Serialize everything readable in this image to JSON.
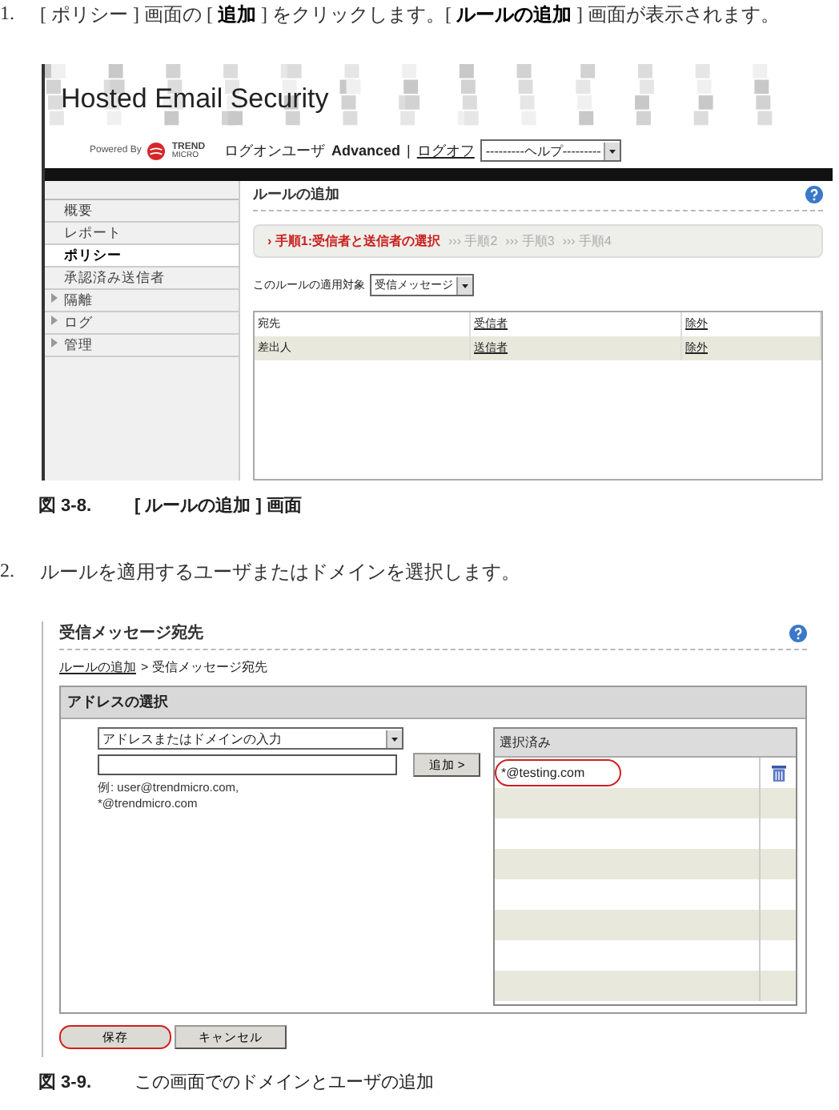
{
  "steps": [
    {
      "number": "1.",
      "text": "[ ポリシー ] 画面の [ **追加** ] をクリックします。[ **ルールの追加** ] 画面が表示されます。"
    },
    {
      "number": "2.",
      "text": "ルールを適用するユーザまたはドメインを選択します。"
    }
  ],
  "figure1": {
    "caption_number": "図 3-8.",
    "caption": "[ ルールの追加 ] 画面",
    "header": {
      "title": "Hosted Email Security",
      "powered_by": "Powered By",
      "logo_text": "TREND",
      "logo_subtext": "MICRO",
      "user_label": "ログオンユーザ",
      "user_name": "Advanced",
      "separator": "|",
      "logoff": "ログオフ",
      "help_select": "---------ヘルプ---------"
    },
    "sidebar": [
      {
        "label": "概要",
        "kind": "page",
        "selected": false
      },
      {
        "label": "レポート",
        "kind": "page",
        "selected": false
      },
      {
        "label": "ポリシー",
        "kind": "page",
        "selected": true
      },
      {
        "label": "承認済み送信者",
        "kind": "page",
        "selected": false
      },
      {
        "label": "隔離",
        "kind": "group",
        "selected": false
      },
      {
        "label": "ログ",
        "kind": "group",
        "selected": false
      },
      {
        "label": "管理",
        "kind": "group",
        "selected": false
      }
    ],
    "page_title": "ルールの追加",
    "steps": [
      {
        "prefix": "›",
        "label": "手順1:受信者と送信者の選択",
        "selected": true
      },
      {
        "prefix": "›››",
        "label": "手順2",
        "selected": false
      },
      {
        "prefix": "›››",
        "label": "手順3",
        "selected": false
      },
      {
        "prefix": "›››",
        "label": "手順4",
        "selected": false
      }
    ],
    "apply_label": "このルールの適用対象",
    "apply_select": "受信メッセージ",
    "rows": [
      {
        "cells": [
          "宛先",
          "受信者",
          "除外"
        ],
        "selected": false
      },
      {
        "cells": [
          "差出人",
          "送信者",
          "除外"
        ],
        "selected": true
      }
    ]
  },
  "figure2": {
    "caption_number": "図 3-9.",
    "caption": "この画面でのドメインとユーザの追加",
    "title": "受信メッセージ宛先",
    "breadcrumb_link": "ルールの追加",
    "breadcrumb_rest": "> 受信メッセージ宛先",
    "panel_title": "アドレスの選択",
    "type_select": "アドレスまたはドメインの入力",
    "hint_lines": [
      "例: user@trendmicro.com,",
      "*@trendmicro.com"
    ],
    "add_button": "追加 >",
    "selected_header": "選択済み",
    "selected_items": [
      {
        "text": "*@testing.com",
        "highlighted": true
      }
    ],
    "buttons": [
      {
        "label": "保存",
        "highlighted": true
      },
      {
        "label": "キャンセル",
        "highlighted": false
      }
    ]
  }
}
